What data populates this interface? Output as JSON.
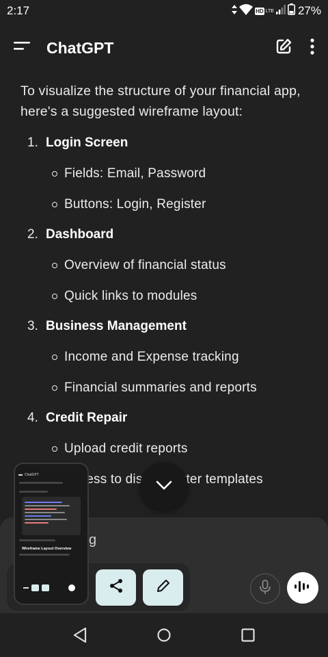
{
  "status_bar": {
    "time": "2:17",
    "hd_label": "HD",
    "lte_label": "LTE",
    "battery": "27%"
  },
  "app_bar": {
    "title": "ChatGPT"
  },
  "message": {
    "intro": "To visualize the structure of your financial app, here's a suggested wireframe layout:",
    "items": [
      {
        "number": "1.",
        "heading": "Login Screen",
        "subitems": [
          "Fields: Email, Password",
          "Buttons: Login, Register"
        ]
      },
      {
        "number": "2.",
        "heading": "Dashboard",
        "subitems": [
          "Overview of financial status",
          "Quick links to modules"
        ]
      },
      {
        "number": "3.",
        "heading": "Business Management",
        "subitems": [
          "Income and Expense tracking",
          "Financial summaries and reports"
        ]
      },
      {
        "number": "4.",
        "heading": "Credit Repair",
        "subitems": [
          "Upload credit reports",
          "Access to dispute letter templates"
        ]
      }
    ]
  },
  "composer": {
    "partial_text": "g"
  },
  "thumbnail": {
    "app_title": "ChatGPT",
    "caption": "Wireframe Layout Overview"
  },
  "icons": {
    "menu": "menu-icon",
    "new_chat": "edit-icon",
    "more": "more-vertical-icon",
    "scroll_down": "chevron-down-icon",
    "share": "share-icon",
    "edit": "pencil-icon",
    "mic": "microphone-icon",
    "voice": "voice-waveform-icon",
    "back": "back-triangle-icon",
    "home": "home-circle-icon",
    "recents": "recents-square-icon"
  },
  "colors": {
    "background": "#212121",
    "composer": "#2f2f2f",
    "action_button": "#d9ecee"
  }
}
